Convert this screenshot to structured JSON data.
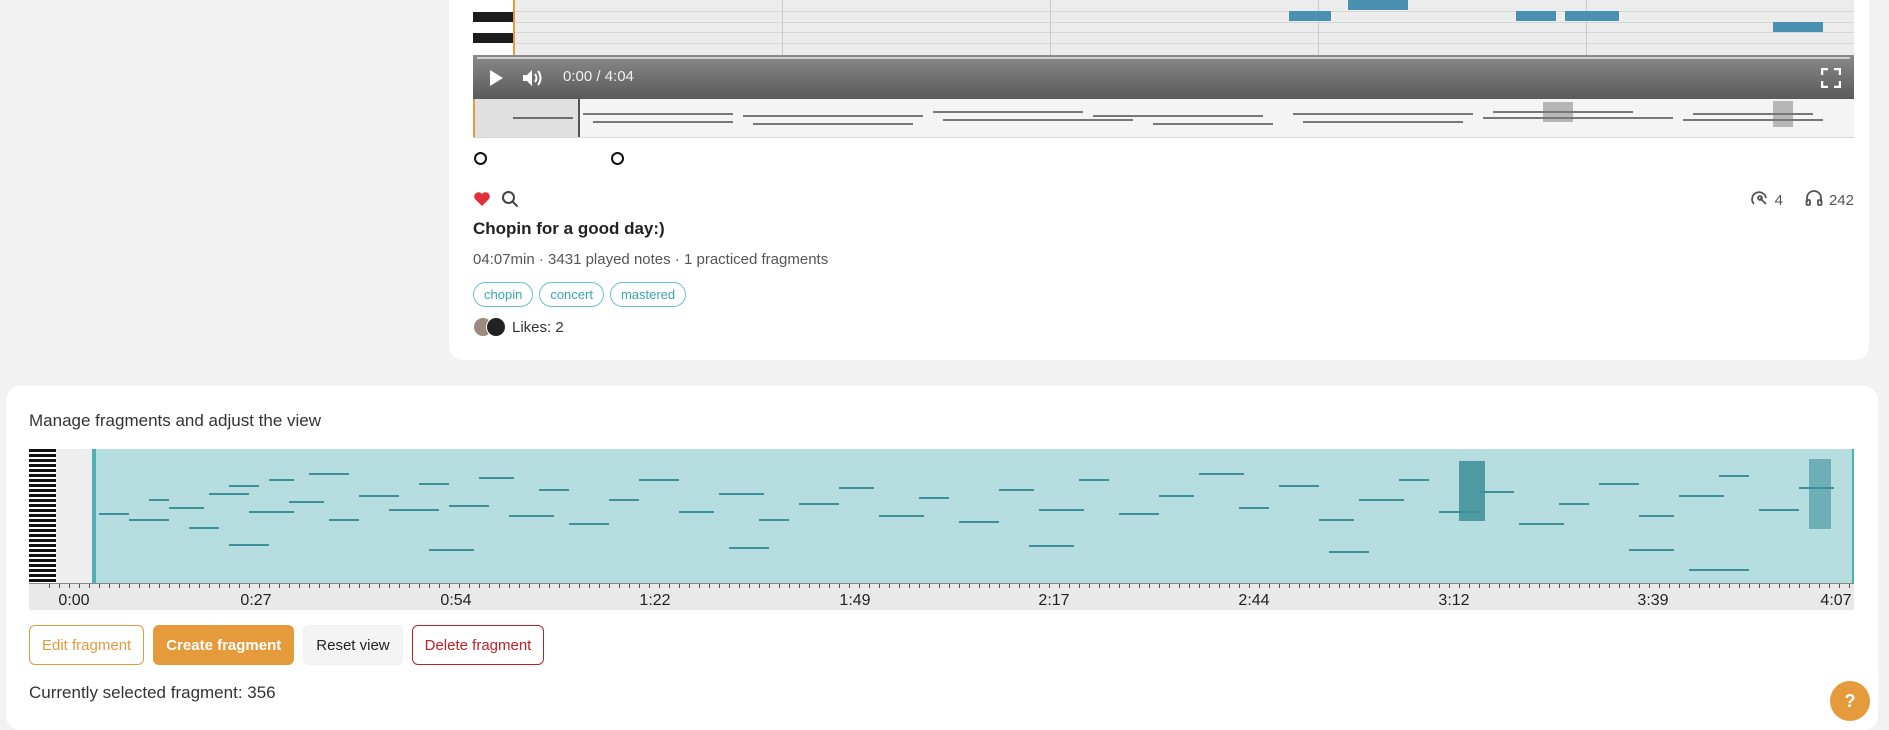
{
  "player": {
    "time_display": "0:00 / 4:04",
    "icons": {
      "play": "play-icon",
      "volume": "volume-icon",
      "fullscreen": "fullscreen-icon"
    }
  },
  "song": {
    "title": "Chopin for a good day:)",
    "meta": "04:07min · 3431 played notes · 1 practiced fragments",
    "tags": [
      "chopin",
      "concert",
      "mastered"
    ],
    "likes_label": "Likes: 2",
    "stats": {
      "practice_count": "4",
      "listens_count": "242"
    },
    "icons": {
      "like": "heart-icon",
      "search": "search-icon",
      "practice": "practice-icon",
      "listens": "headphones-icon"
    },
    "like_color": "#e0303b"
  },
  "manager": {
    "heading": "Manage fragments and adjust the view",
    "timeline_labels": [
      "0:00",
      "0:27",
      "0:54",
      "1:22",
      "1:49",
      "2:17",
      "2:44",
      "3:12",
      "3:39",
      "4:07"
    ],
    "buttons": {
      "edit": "Edit fragment",
      "create": "Create fragment",
      "reset": "Reset view",
      "delete": "Delete fragment"
    },
    "selected_fragment": "Currently selected fragment: 356",
    "help": "?"
  },
  "colors": {
    "accent": "#e59a3b",
    "teal": "#4fb0b8",
    "danger": "#bb2222"
  }
}
